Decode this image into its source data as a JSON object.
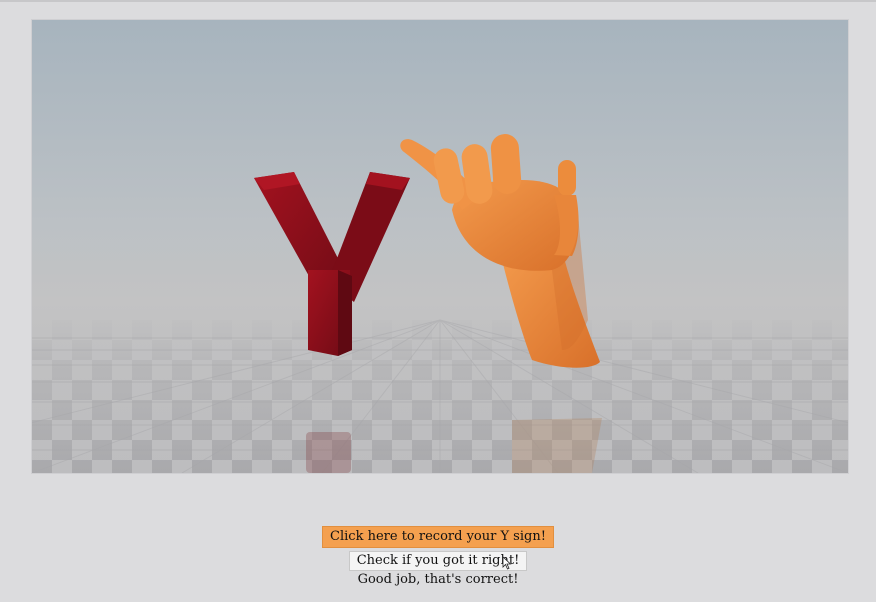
{
  "scene": {
    "letter": "Y",
    "letter_color": "#8e0f1b",
    "hand_color": "#ee8a3a",
    "background_top": "#a9b6c0",
    "background_bottom": "#bfc0c2"
  },
  "controls": {
    "record_label": "Click here to record your Y sign!",
    "check_label": "Check if you got it right!",
    "feedback_text": "Good job, that's correct!"
  },
  "colors": {
    "record_button": "#f4a04f",
    "page_background": "#dcdcde"
  }
}
